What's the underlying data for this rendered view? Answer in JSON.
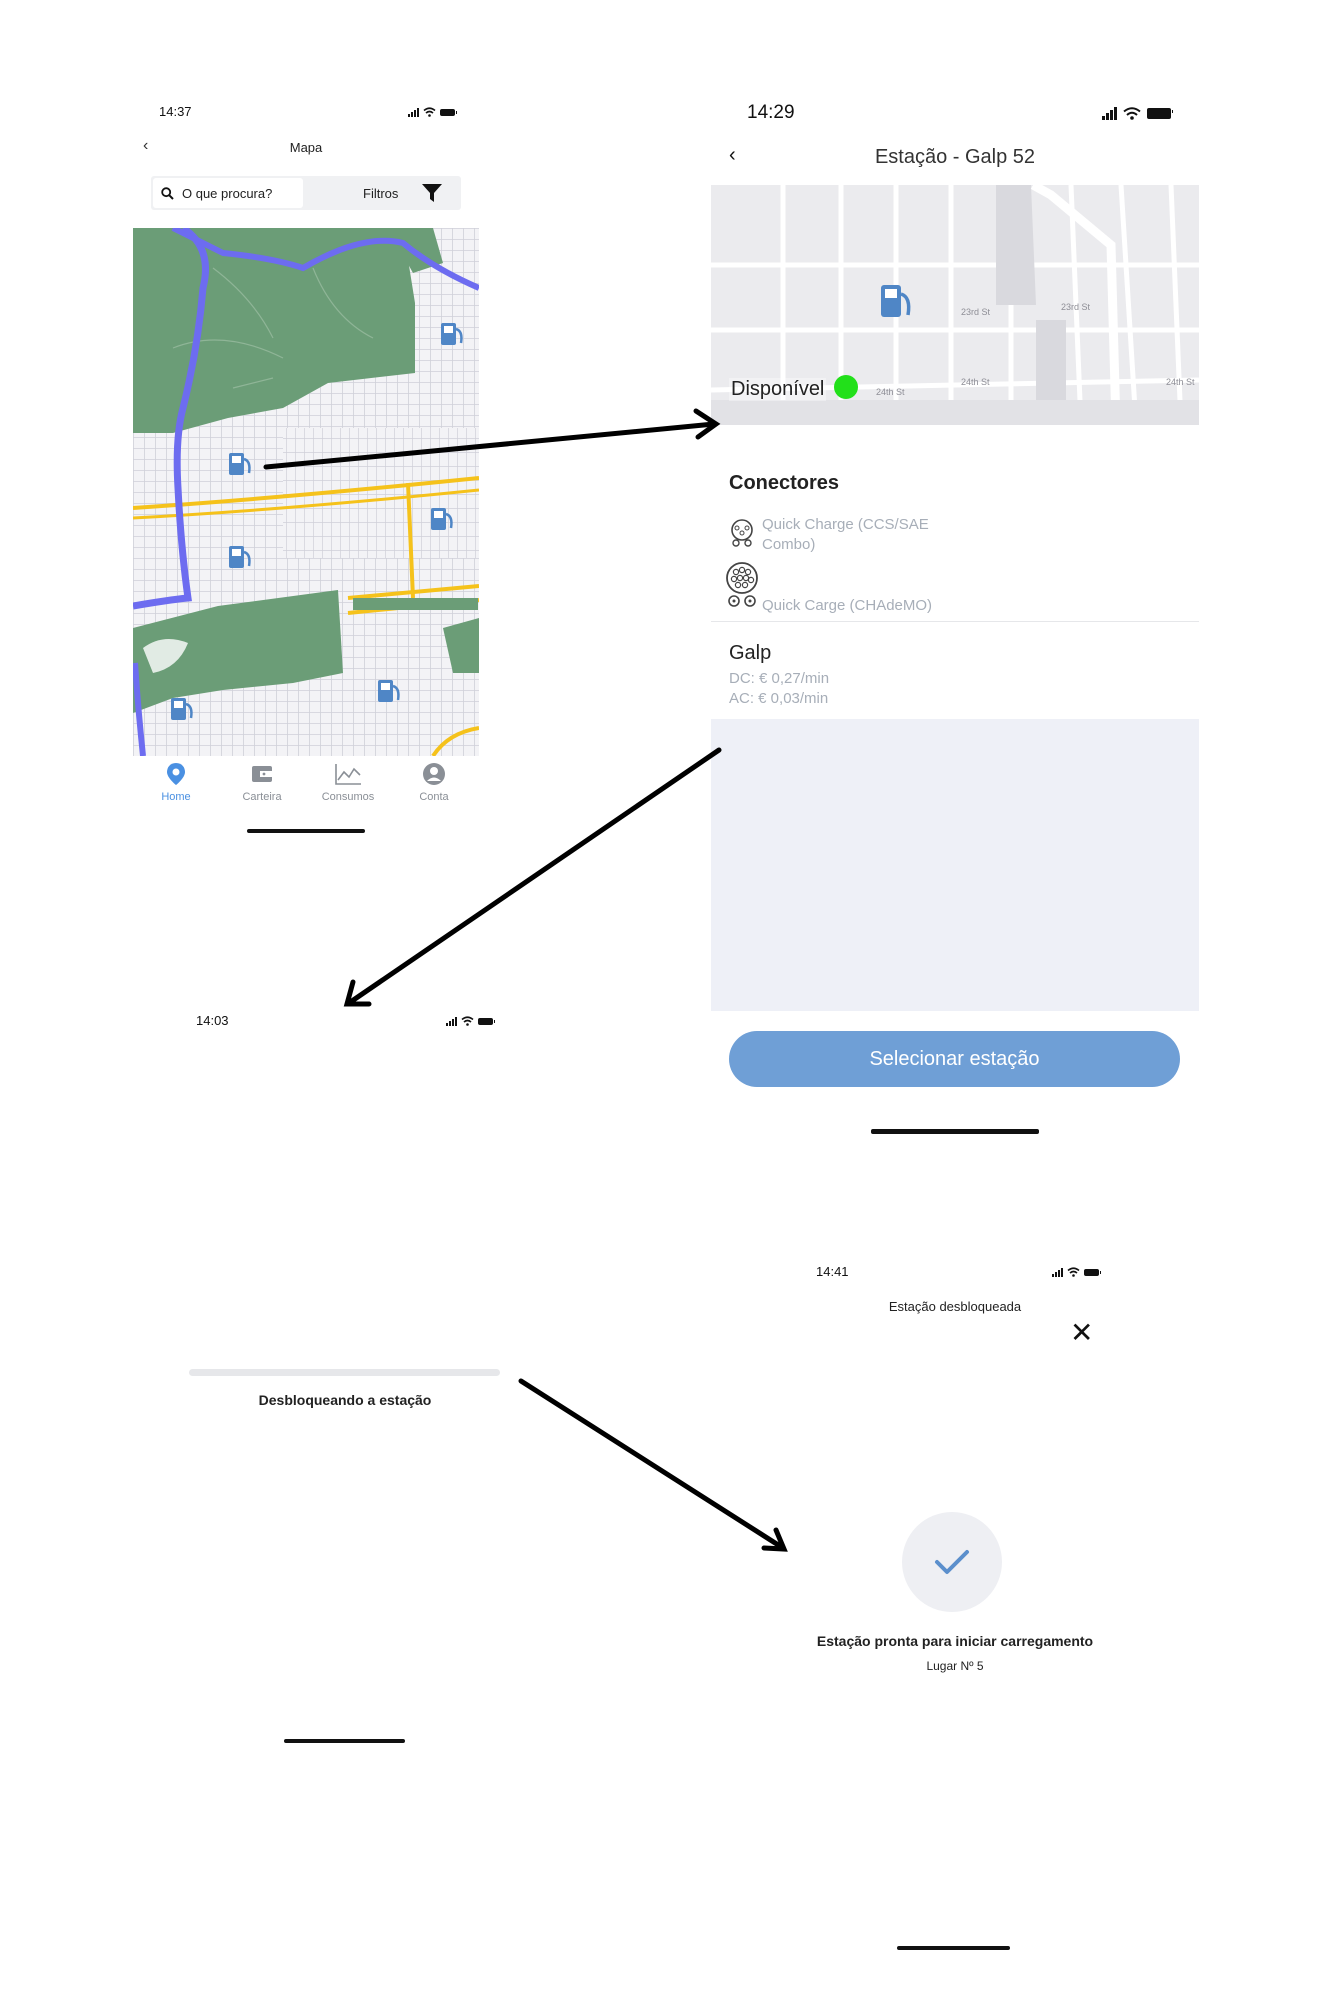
{
  "screen_map": {
    "time": "14:37",
    "title": "Mapa",
    "back_icon": "chevron-left-icon",
    "search_placeholder": "O que procura?",
    "filters_label": "Filtros",
    "tabs": [
      {
        "label": "Home",
        "icon": "map-pin-icon",
        "active": true
      },
      {
        "label": "Carteira",
        "icon": "wallet-icon",
        "active": false
      },
      {
        "label": "Consumos",
        "icon": "chart-icon",
        "active": false
      },
      {
        "label": "Conta",
        "icon": "user-icon",
        "active": false
      }
    ]
  },
  "screen_station": {
    "time": "14:29",
    "title": "Estação - Galp 52",
    "status": "Disponível",
    "status_color": "#22e01a",
    "connectors_heading": "Conectores",
    "connectors": [
      {
        "name_line1": "Quick Charge (CCS/SAE",
        "name_line2": "Combo)"
      },
      {
        "name_line1": "Quick Carge (CHAdeMO)"
      }
    ],
    "operator": "Galp",
    "price_dc": "DC: € 0,27/min",
    "price_ac": "AC: € 0,03/min",
    "select_button": "Selecionar estação",
    "accent_color": "#6f9fd6"
  },
  "screen_unlocking": {
    "time": "14:03",
    "message": "Desbloqueando a estação"
  },
  "screen_unlocked": {
    "time": "14:41",
    "title": "Estação desbloqueada",
    "message": "Estação pronta para iniciar carregamento",
    "spot": "Lugar Nº 5"
  }
}
